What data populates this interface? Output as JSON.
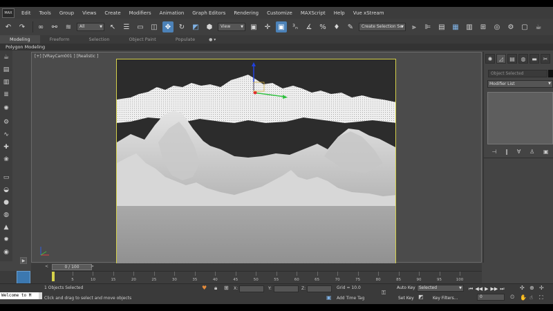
{
  "menu": {
    "logo": "MAX",
    "items": [
      "Edit",
      "Tools",
      "Group",
      "Views",
      "Create",
      "Modifiers",
      "Animation",
      "Graph Editors",
      "Rendering",
      "Customize",
      "MAXScript",
      "Help",
      "Vue xStream"
    ]
  },
  "toolbar": {
    "filter_value": "All",
    "refcoord_value": "View",
    "named_selection": "Create Selection Se"
  },
  "ribbon": {
    "tabs": [
      "Modeling",
      "Freeform",
      "Selection",
      "Object Paint",
      "Populate"
    ],
    "active_tab": "Modeling",
    "sub_label": "Polygon Modeling"
  },
  "viewport": {
    "label": "[+] [VRayCam001 ] [Realistic ]"
  },
  "command_panel": {
    "object_name_placeholder": "Object Selected",
    "modifier_list": "Modifier List"
  },
  "timeline": {
    "frame_display": "0 / 100",
    "prev": "<",
    "next": ">",
    "ticks": [
      "5",
      "10",
      "15",
      "20",
      "25",
      "30",
      "35",
      "40",
      "45",
      "50",
      "55",
      "60",
      "65",
      "70",
      "75",
      "80",
      "85",
      "90",
      "95",
      "100"
    ]
  },
  "status": {
    "maxscript": "Welcome to M",
    "selected_count": "1 Objects Selected",
    "prompt": "Click and drag to select and move objects",
    "x_label": "X:",
    "y_label": "Y:",
    "z_label": "Z:",
    "grid": "Grid = 10.0",
    "add_time_tag": "Add Time Tag",
    "auto_key": "Auto Key",
    "set_key": "Set Key",
    "selected_dropdown": "Selected",
    "key_filters": "Key Filters...",
    "current_frame": "0"
  },
  "colors": {
    "viewport_border": "#d5d14a",
    "active_blue": "#4c82b8",
    "gizmo_x": "#e03030",
    "gizmo_y": "#30c040",
    "gizmo_z": "#2040e0"
  }
}
